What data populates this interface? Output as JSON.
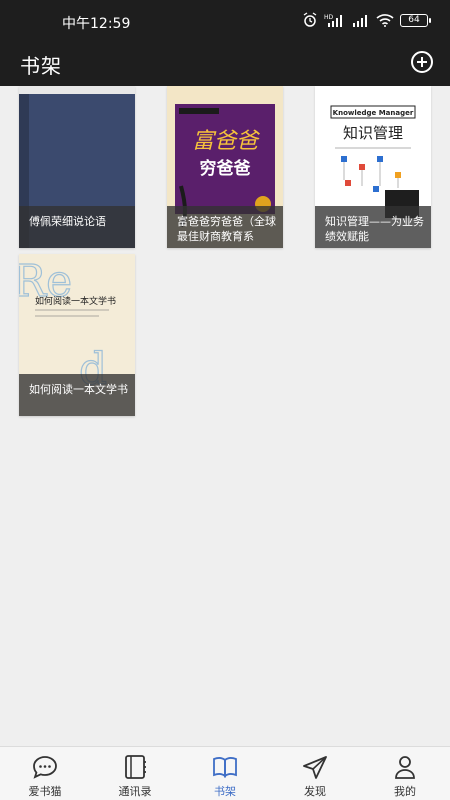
{
  "status": {
    "time": "中午12:59",
    "battery": "64"
  },
  "appbar": {
    "title": "书架",
    "add_icon": "plus-circle-icon"
  },
  "books": [
    {
      "title": "傅佩荣细说论语",
      "cover_color": "#3b4a6e"
    },
    {
      "title": "富爸爸穷爸爸（全球最佳财商教育系",
      "cover_color": "#5a1f6b",
      "cover_title_main": "富爸爸",
      "cover_title_sub": "穷爸爸"
    },
    {
      "title": "知识管理——为业务绩效赋能",
      "cover_color": "#ffffff",
      "cover_title_main": "知识管理",
      "cover_badge": "Knowledge Manager"
    },
    {
      "title": "如何阅读一本文学书",
      "cover_color": "#f4ecd8",
      "cover_title_main": "如何阅读一本文学书"
    }
  ],
  "bottom_nav": [
    {
      "label": "爱书猫",
      "icon": "chat-icon",
      "active": false
    },
    {
      "label": "通讯录",
      "icon": "contacts-icon",
      "active": false
    },
    {
      "label": "书架",
      "icon": "book-icon",
      "active": true
    },
    {
      "label": "发现",
      "icon": "send-icon",
      "active": false
    },
    {
      "label": "我的",
      "icon": "person-icon",
      "active": false
    }
  ],
  "colors": {
    "bar_bg": "#1e1e1e",
    "accent": "#3f6ec6",
    "background": "#efefef"
  }
}
